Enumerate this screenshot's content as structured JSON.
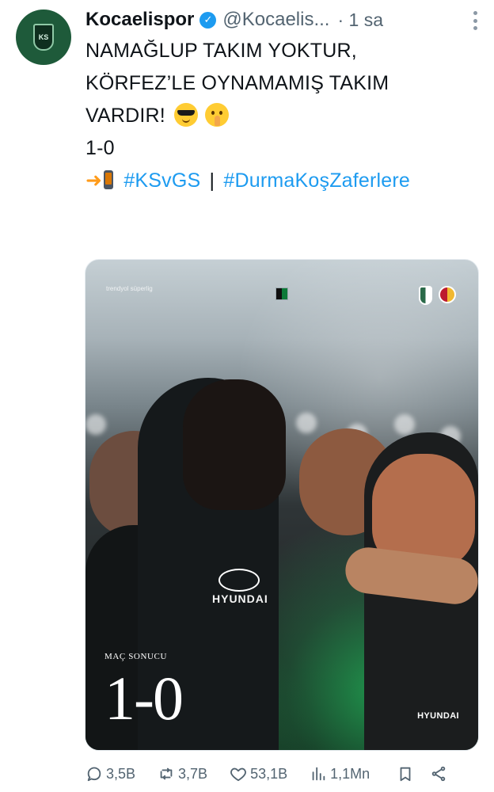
{
  "account": {
    "display_name": "Kocaelispor",
    "handle": "@Kocaelis...",
    "time": "· 1 sa"
  },
  "post": {
    "lines": [
      "NAMAĞLUP TAKIM YOKTUR,",
      "KÖRFEZ’LE OYNAMAMIŞ TAKIM",
      "VARDIR!",
      "",
      "1-0",
      ""
    ],
    "hashtag_1": "#KSvGS",
    "separator": "|",
    "hashtag_2": "#DurmaKoşZaferlere"
  },
  "media": {
    "league_brand": "trendyol süperlig",
    "result_label": "MAÇ SONUCU",
    "score": "1-0",
    "sponsor": "HYUNDAI",
    "jersey_sponsor": "HYUNDAI",
    "accent_color": "#21b95a"
  },
  "actions": {
    "replies": "3,5B",
    "reposts": "3,7B",
    "likes": "53,1B",
    "views": "1,1Mn"
  },
  "icons": {
    "verified": "verified-badge-icon",
    "more": "more-options-icon",
    "reply": "reply-icon",
    "repost": "repost-icon",
    "like": "heart-icon",
    "views": "views-chart-icon",
    "bookmark": "bookmark-icon",
    "share": "share-icon"
  }
}
